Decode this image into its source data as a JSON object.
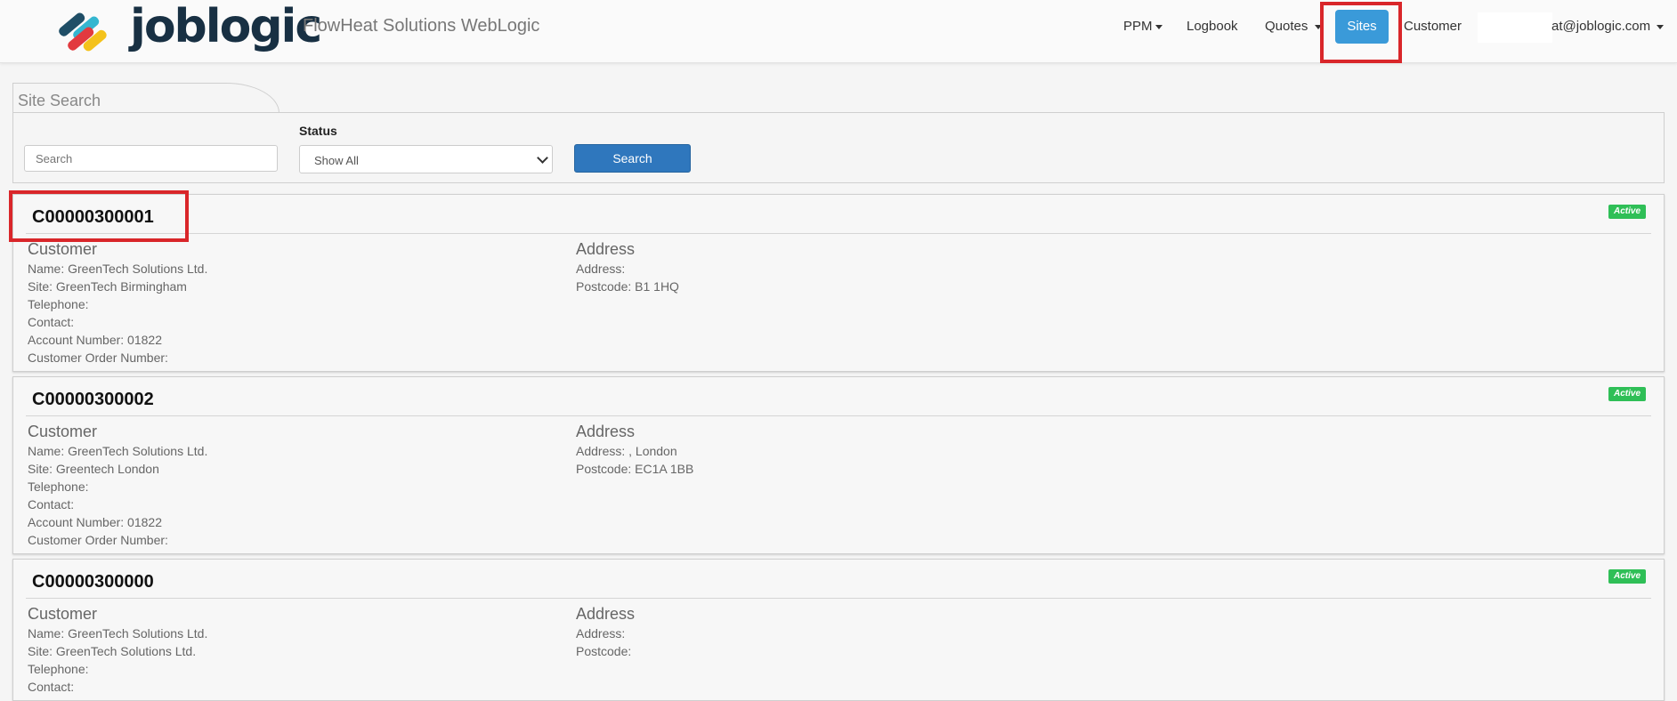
{
  "header": {
    "logo_text": "joblogic",
    "app_title": "FlowHeat Solutions WebLogic",
    "nav": {
      "ppm": "PPM",
      "logbook": "Logbook",
      "quotes": "Quotes",
      "sites": "Sites",
      "customer": "Customer",
      "user": "at@joblogic.com"
    }
  },
  "search": {
    "tab_title": "Site Search",
    "placeholder": "Search",
    "status_label": "Status",
    "status_value": "Show All",
    "button_label": "Search"
  },
  "sites": [
    {
      "code": "C00000300001",
      "status": "Active",
      "customer_heading": "Customer",
      "name": "Name: GreenTech Solutions Ltd.",
      "site": "Site: GreenTech Birmingham",
      "telephone": "Telephone:",
      "contact": "Contact:",
      "account": "Account Number: 01822",
      "order": "Customer Order Number:",
      "address_heading": "Address",
      "address": "Address:",
      "postcode": "Postcode: B1 1HQ"
    },
    {
      "code": "C00000300002",
      "status": "Active",
      "customer_heading": "Customer",
      "name": "Name: GreenTech Solutions Ltd.",
      "site": "Site: Greentech London",
      "telephone": "Telephone:",
      "contact": "Contact:",
      "account": "Account Number: 01822",
      "order": "Customer Order Number:",
      "address_heading": "Address",
      "address": "Address: , London",
      "postcode": "Postcode: EC1A 1BB"
    },
    {
      "code": "C00000300000",
      "status": "Active",
      "customer_heading": "Customer",
      "name": "Name: GreenTech Solutions Ltd.",
      "site": "Site: GreenTech Solutions Ltd.",
      "telephone": "Telephone:",
      "contact": "Contact:",
      "account": "",
      "order": "",
      "address_heading": "Address",
      "address": "Address:",
      "postcode": "Postcode:"
    }
  ],
  "colors": {
    "accent": "#3a9ad9",
    "button": "#2f77bd",
    "badge": "#2fbf57",
    "highlight": "#d9262a"
  }
}
